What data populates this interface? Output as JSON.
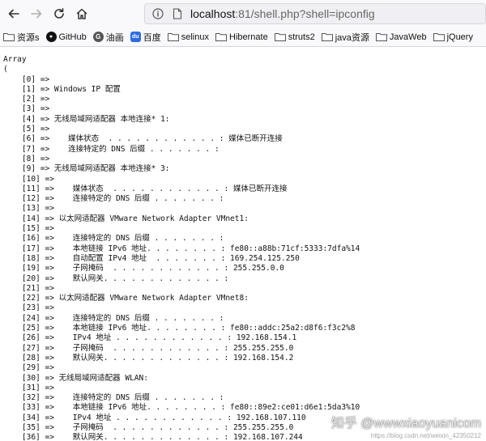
{
  "browser": {
    "url_host": "localhost",
    "url_rest": ":81/shell.php?shell=ipconfig"
  },
  "bookmarks": [
    {
      "label": "资源s",
      "icon": "folder-icon"
    },
    {
      "label": "GitHub",
      "icon": "github-icon"
    },
    {
      "label": "油画",
      "icon": "g-icon"
    },
    {
      "label": "百度",
      "icon": "baidu-icon"
    },
    {
      "label": "selinux",
      "icon": "folder-icon"
    },
    {
      "label": "Hibernate",
      "icon": "folder-icon"
    },
    {
      "label": "struts2",
      "icon": "folder-icon"
    },
    {
      "label": "java资源",
      "icon": "folder-icon"
    },
    {
      "label": "JavaWeb",
      "icon": "folder-icon"
    },
    {
      "label": "jQuery",
      "icon": "folder-icon"
    }
  ],
  "output": {
    "lines": [
      "Array",
      "(",
      "    [0] =>",
      "    [1] => Windows IP 配置",
      "    [2] =>",
      "    [3] =>",
      "    [4] => 无线局域网适配器 本地连接* 1:",
      "    [5] =>",
      "    [6] =>    媒体状态  . . . . . . . . . . . . : 媒体已断开连接",
      "    [7] =>    连接特定的 DNS 后缀 . . . . . . . :",
      "    [8] =>",
      "    [9] => 无线局域网适配器 本地连接* 3:",
      "    [10] =>",
      "    [11] =>    媒体状态  . . . . . . . . . . . . : 媒体已断开连接",
      "    [12] =>    连接特定的 DNS 后缀 . . . . . . . :",
      "    [13] =>",
      "    [14] => 以太网适配器 VMware Network Adapter VMnet1:",
      "    [15] =>",
      "    [16] =>    连接特定的 DNS 后缀 . . . . . . . :",
      "    [17] =>    本地链接 IPv6 地址. . . . . . . . : fe80::a88b:71cf:5333:7dfa%14",
      "    [18] =>    自动配置 IPv4 地址  . . . . . . . : 169.254.125.250",
      "    [19] =>    子网掩码  . . . . . . . . . . . . : 255.255.0.0",
      "    [20] =>    默认网关. . . . . . . . . . . . . :",
      "    [21] =>",
      "    [22] => 以太网适配器 VMware Network Adapter VMnet8:",
      "    [23] =>",
      "    [24] =>    连接特定的 DNS 后缀 . . . . . . . :",
      "    [25] =>    本地链接 IPv6 地址. . . . . . . . : fe80::addc:25a2:d8f6:f3c2%8",
      "    [26] =>    IPv4 地址 . . . . . . . . . . . . : 192.168.154.1",
      "    [27] =>    子网掩码  . . . . . . . . . . . . : 255.255.255.0",
      "    [28] =>    默认网关. . . . . . . . . . . . . : 192.168.154.2",
      "    [29] =>",
      "    [30] => 无线局域网适配器 WLAN:",
      "    [31] =>",
      "    [32] =>    连接特定的 DNS 后缀 . . . . . . . :",
      "    [33] =>    本地链接 IPv6 地址. . . . . . . . : fe80::89e2:ce01:d6e1:5da3%10",
      "    [34] =>    IPv4 地址 . . . . . . . . . . . . : 192.168.107.110",
      "    [35] =>    子网掩码  . . . . . . . . . . . . : 255.255.255.0",
      "    [36] =>    默认网关. . . . . . . . . . . . . : 192.168.107.244"
    ]
  },
  "watermark": {
    "text": "知乎 @wwwxiaoyuanicom",
    "sub": "https://blog.csdn.net/weixin_42350212"
  }
}
